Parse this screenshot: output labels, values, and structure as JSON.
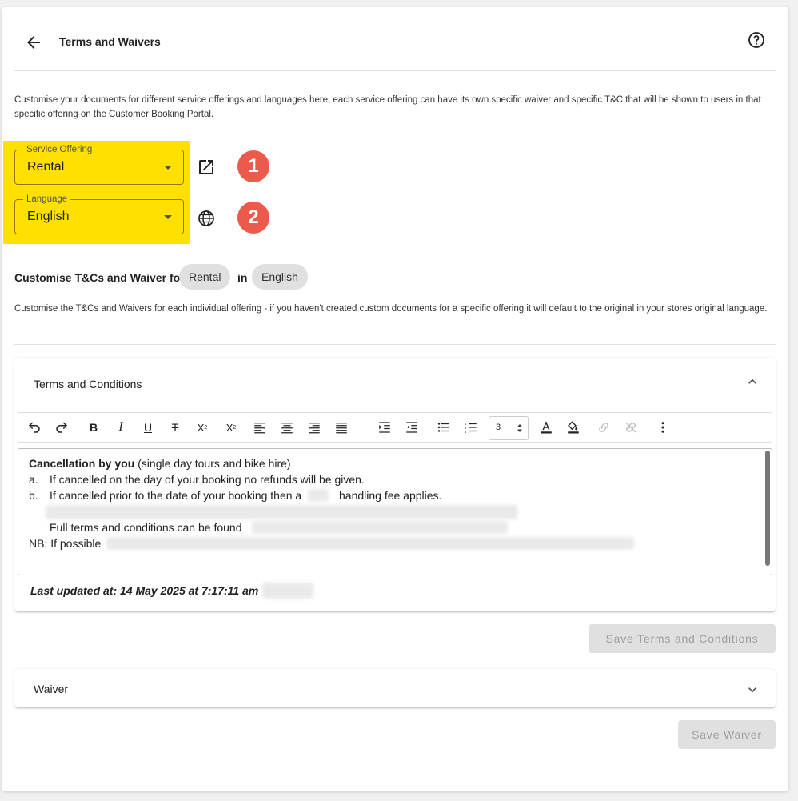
{
  "header": {
    "title": "Terms and Waivers",
    "icons": [
      "arrow-left-icon",
      "help-circle-icon"
    ]
  },
  "intro_text": "Customise your documents for different service offerings and languages here, each service offering can have its own specific waiver and specific T&C that will be shown to users in that specific offering on the Customer Booking Portal.",
  "service_offering": {
    "label": "Service Offering",
    "value": "Rental"
  },
  "language": {
    "label": "Language",
    "value": "English"
  },
  "annotations": [
    "1",
    "2"
  ],
  "customise": {
    "prefix": "Customise T&Cs and Waiver for",
    "chip_offering": "Rental",
    "connector": "in",
    "chip_language": "English",
    "description": "Customise the T&Cs and Waivers for each individual offering - if you haven't created custom documents for a specific offering it will default to the original in your stores original language."
  },
  "terms_panel": {
    "title": "Terms and Conditions",
    "font_size_value": "3",
    "editor": {
      "heading_bold": "Cancellation by you",
      "heading_rest": " (single day tours and bike hire)",
      "item_a_marker": "a.",
      "item_a": "If cancelled on the day of your booking no refunds will be given.",
      "item_b_marker": "b.",
      "item_b_prefix": "If cancelled prior to the date of your booking then a",
      "item_b_suffix": "handling fee applies.",
      "full_terms": "Full terms and conditions can be found",
      "nb": "NB: If possible"
    },
    "last_updated": "Last updated at: 14 May 2025 at 7:17:11 am",
    "save_label": "Save Terms and Conditions"
  },
  "waiver_panel": {
    "title": "Waiver",
    "save_label": "Save Waiver"
  },
  "colors": {
    "highlight": "#ffe000",
    "badge": "#ec5a4c",
    "chip": "#e0e0e0"
  }
}
